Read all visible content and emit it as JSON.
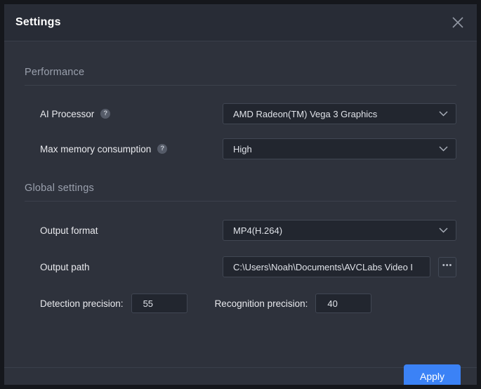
{
  "window": {
    "title": "Settings",
    "close_icon": "close-icon"
  },
  "sections": {
    "performance": {
      "title": "Performance",
      "fields": {
        "ai_processor": {
          "label": "AI Processor",
          "help_icon": "help-icon",
          "value": "AMD Radeon(TM) Vega 3 Graphics",
          "chevron_icon": "chevron-down-icon"
        },
        "max_memory": {
          "label": "Max memory consumption",
          "help_icon": "help-icon",
          "value": "High",
          "chevron_icon": "chevron-down-icon"
        }
      }
    },
    "global": {
      "title": "Global settings",
      "fields": {
        "output_format": {
          "label": "Output format",
          "value": "MP4(H.264)",
          "chevron_icon": "chevron-down-icon"
        },
        "output_path": {
          "label": "Output path",
          "value": "C:\\Users\\Noah\\Documents\\AVCLabs Video I",
          "browse_label": "•••"
        },
        "detection_precision": {
          "label": "Detection precision:",
          "value": "55"
        },
        "recognition_precision": {
          "label": "Recognition precision:",
          "value": "40"
        }
      }
    }
  },
  "footer": {
    "apply_label": "Apply"
  },
  "colors": {
    "accent": "#3b82f6",
    "dialog_bg": "#2e323c",
    "titlebar_bg": "#282c36",
    "input_bg": "#22262f",
    "border": "#414753",
    "text_primary": "#e9eaee",
    "text_muted": "#9aa0ad"
  }
}
